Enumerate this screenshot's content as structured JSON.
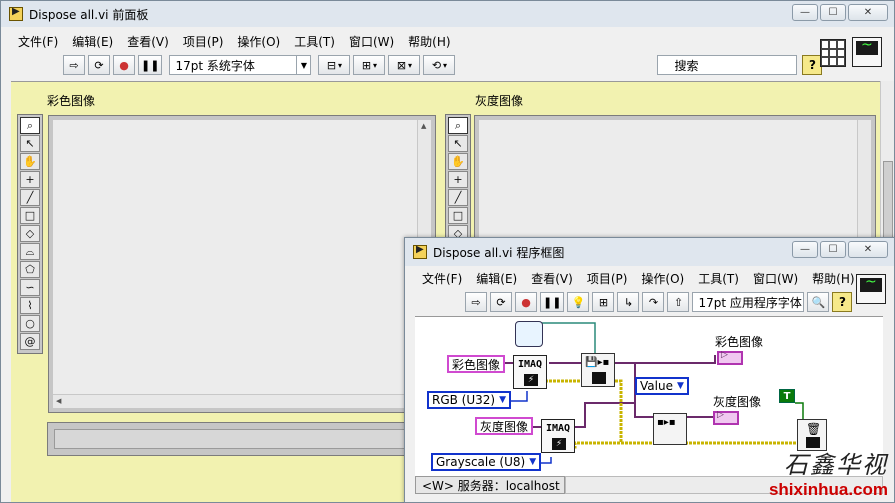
{
  "front_panel": {
    "title": "Dispose all.vi 前面板",
    "menu": [
      "文件(F)",
      "编辑(E)",
      "查看(V)",
      "项目(P)",
      "操作(O)",
      "工具(T)",
      "窗口(W)",
      "帮助(H)"
    ],
    "font_label": "17pt 系统字体",
    "search_placeholder": "搜索",
    "help_label": "?",
    "color_image_label": "彩色图像",
    "gray_image_label": "灰度图像",
    "palette_tools": [
      "zoom-icon",
      "pointer-icon",
      "pan-icon",
      "crosshair-icon",
      "line-icon",
      "rectangle-icon",
      "rotated-rect-icon",
      "annulus-icon",
      "polygon-icon",
      "freehand-icon",
      "broken-line-icon",
      "oval-icon",
      "spiral-icon"
    ]
  },
  "block_diagram": {
    "title": "Dispose all.vi 程序框图",
    "menu": [
      "文件(F)",
      "编辑(E)",
      "查看(V)",
      "项目(P)",
      "操作(O)",
      "工具(T)",
      "窗口(W)",
      "帮助(H)"
    ],
    "font_label": "17pt 应用程序字体",
    "help_label": "?",
    "nodes": {
      "imaq_label": "IMAQ",
      "color_ctrl": "彩色图像",
      "gray_ctrl": "灰度图像",
      "rgb_type": "RGB (U32)",
      "gray_type": "Grayscale (U8)",
      "value_ctrl": "Value",
      "color_ind": "彩色图像",
      "gray_ind": "灰度图像",
      "bool_const": "T"
    },
    "status_server": "<W> 服务器：localhost"
  },
  "watermark": {
    "cn": "石鑫华视",
    "url": "shixinhua.com"
  },
  "colors": {
    "titlebar": "#dfe6ee",
    "fp_canvas": "#f2f2b0",
    "image_wire": "#6b2a6b",
    "error_wire": "#c8b400",
    "pink_border": "#d04ad0",
    "blue_border": "#1133cc"
  }
}
